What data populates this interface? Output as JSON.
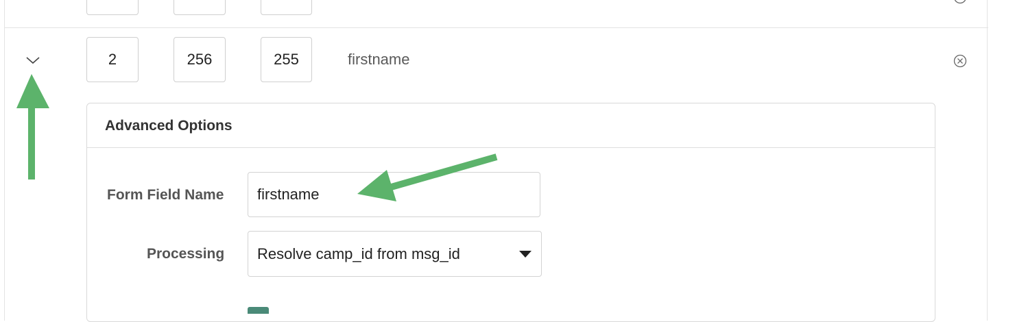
{
  "previous_row": {
    "values": [
      "",
      "",
      ""
    ]
  },
  "current_row": {
    "values": [
      "2",
      "256",
      "255"
    ],
    "label": "firstname"
  },
  "advanced_options": {
    "title": "Advanced Options",
    "form_field_name": {
      "label": "Form Field Name",
      "value": "firstname"
    },
    "processing": {
      "label": "Processing",
      "selected": "Resolve camp_id from msg_id"
    }
  },
  "annotations": {
    "arrow_color": "#5cb36b"
  }
}
